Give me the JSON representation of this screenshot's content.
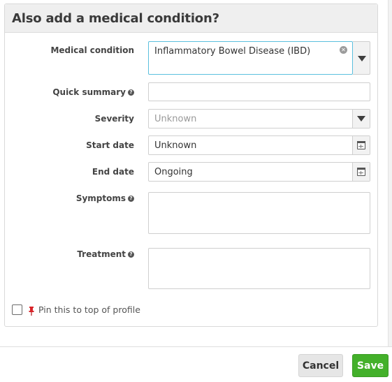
{
  "dialog": {
    "title": "Also add a medical condition?"
  },
  "form": {
    "medical_condition": {
      "label": "Medical condition",
      "value": "Inflammatory Bowel Disease (IBD)"
    },
    "quick_summary": {
      "label": "Quick summary",
      "value": ""
    },
    "severity": {
      "label": "Severity",
      "value": "Unknown"
    },
    "start_date": {
      "label": "Start date",
      "value": "Unknown"
    },
    "end_date": {
      "label": "End date",
      "value": "Ongoing"
    },
    "symptoms": {
      "label": "Symptoms",
      "value": ""
    },
    "treatment": {
      "label": "Treatment",
      "value": ""
    },
    "pin": {
      "label": "Pin this to top of profile",
      "checked": false
    }
  },
  "footer": {
    "cancel_label": "Cancel",
    "save_label": "Save"
  },
  "icons": {
    "help": "help-icon",
    "clear": "clear-icon",
    "dropdown": "chevron-down-icon",
    "calendar": "calendar-icon",
    "pin": "pin-icon"
  },
  "colors": {
    "save_button": "#43b02a",
    "focus_border": "#5bc0de",
    "pin": "#d9252a"
  }
}
